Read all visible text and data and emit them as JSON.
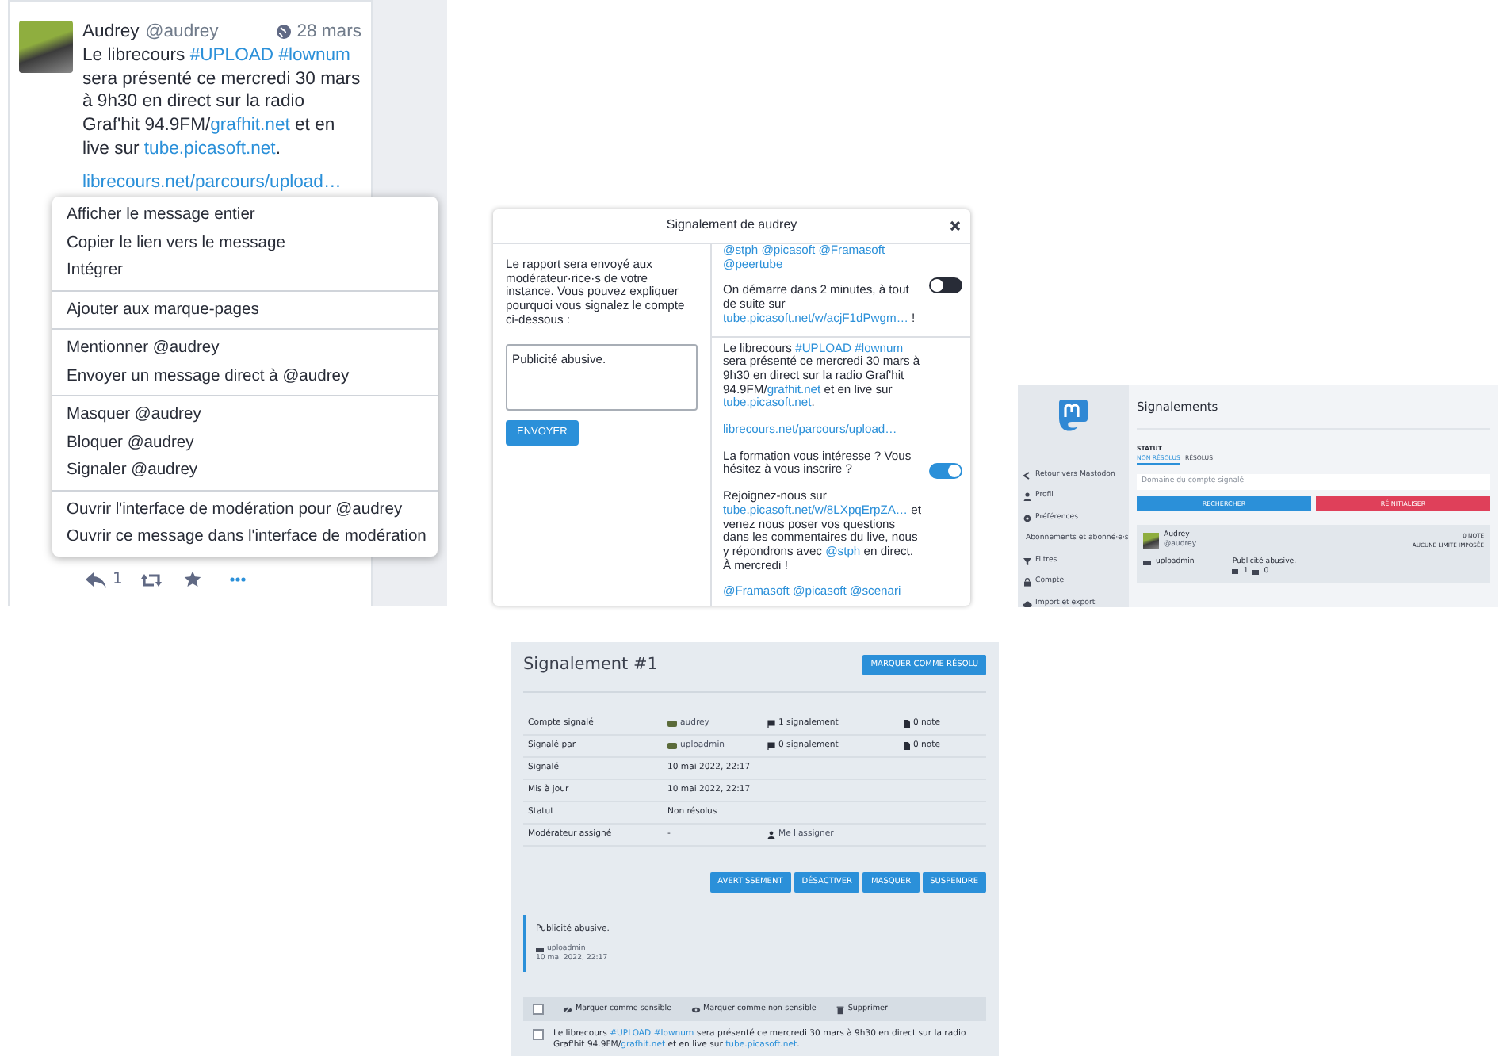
{
  "toot": {
    "author": "Audrey",
    "handle": "@audrey",
    "date": "28 mars",
    "paragraphs": [
      [
        {
          "kind": "text",
          "text": "Le librecours "
        },
        {
          "kind": "hashtag",
          "text": "#UPLOAD"
        },
        {
          "kind": "hashtag",
          "text": "#lownum"
        },
        {
          "kind": "text",
          "text": " sera présenté ce mercredi 30 mars à 9h30 en direct sur la radio Graf'hit 94.9FM/"
        },
        {
          "kind": "link",
          "text": "grafhit.net"
        },
        {
          "kind": "text",
          "text": " et en live sur "
        },
        {
          "kind": "link",
          "text": "tube.picasoft.net"
        },
        {
          "kind": "text",
          "text": "."
        }
      ],
      [
        {
          "kind": "link",
          "text": "librecours.net/parcours/upload…"
        }
      ]
    ],
    "reply_count": "1"
  },
  "context_menu": {
    "groups": [
      [
        "Afficher le message entier",
        "Copier le lien vers le message",
        "Intégrer"
      ],
      [
        "Ajouter aux marque-pages"
      ],
      [
        "Mentionner @audrey",
        "Envoyer un message direct à @audrey"
      ],
      [
        "Masquer @audrey",
        "Bloquer @audrey",
        "Signaler @audrey"
      ],
      [
        "Ouvrir l'interface de modération pour @audrey",
        "Ouvrir ce message dans l'interface de modération"
      ]
    ]
  },
  "report_dialog": {
    "title": "Signalement de audrey",
    "intro": "Le rapport sera envoyé aux modérateur·rice·s de votre instance. Vous pouvez expliquer pourquoi vous signalez le compte ci-dessous :",
    "comment": "Publicité abusive.",
    "submit": "ENVOYER",
    "statuses": [
      {
        "checked": false,
        "paragraphs": [
          [
            {
              "kind": "mention",
              "text": "@stph"
            },
            {
              "kind": "mention",
              "text": "@picasoft"
            },
            {
              "kind": "mention",
              "text": "@Framasoft"
            },
            {
              "kind": "mention",
              "text": "@peertube"
            }
          ],
          [
            {
              "kind": "text",
              "text": "On démarre dans 2 minutes, à tout de suite sur "
            },
            {
              "kind": "url",
              "text": "tube.picasoft.net/w/acjF1dPwgm…"
            },
            {
              "kind": "text",
              "text": " !"
            }
          ]
        ]
      },
      {
        "checked": true,
        "paragraphs": [
          [
            {
              "kind": "text",
              "text": "Le librecours "
            },
            {
              "kind": "hashtag",
              "text": "#UPLOAD"
            },
            {
              "kind": "hashtag",
              "text": "#lownum"
            },
            {
              "kind": "text",
              "text": " sera présenté ce mercredi 30 mars à 9h30 en direct sur la radio Graf'hit 94.9FM/"
            },
            {
              "kind": "link",
              "text": "grafhit.net"
            },
            {
              "kind": "text",
              "text": " et en live sur "
            },
            {
              "kind": "link",
              "text": "tube.picasoft.net"
            },
            {
              "kind": "text",
              "text": "."
            }
          ],
          [
            {
              "kind": "link",
              "text": "librecours.net/parcours/upload…"
            }
          ],
          [
            {
              "kind": "text",
              "text": "La formation vous intéresse ? Vous hésitez à vous inscrire ?"
            }
          ],
          [
            {
              "kind": "text",
              "text": "Rejoignez-nous sur "
            },
            {
              "kind": "url",
              "text": "tube.picasoft.net/w/8LXpqErpZA…"
            },
            {
              "kind": "text",
              "text": " et venez nous poser vos questions dans les commentaires du live, nous y répondrons avec "
            },
            {
              "kind": "mention",
              "text": "@stph"
            },
            {
              "kind": "text",
              "text": " en direct.\nÀ mercredi !"
            }
          ],
          [
            {
              "kind": "mention",
              "text": "@Framasoft"
            },
            {
              "kind": "mention",
              "text": "@picasoft"
            },
            {
              "kind": "mention",
              "text": "@scenari"
            }
          ]
        ]
      }
    ]
  },
  "admin_reports": {
    "sidebar": {
      "items": [
        {
          "kind": "back",
          "label": "Retour vers Mastodon"
        },
        {
          "kind": "user",
          "label": "Profil"
        },
        {
          "kind": "gear",
          "label": "Préférences"
        },
        {
          "kind": "users",
          "label": "Abonnements et abonné·e·s"
        },
        {
          "kind": "filter",
          "label": "Filtres"
        },
        {
          "kind": "lock",
          "label": "Compte"
        },
        {
          "kind": "cloud",
          "label": "Import et export"
        }
      ]
    },
    "title": "Signalements",
    "filter_label": "STATUT",
    "filters": [
      {
        "label": "NON RÉSOLUS",
        "selected": true
      },
      {
        "label": "RÉSOLUS",
        "selected": false
      }
    ],
    "search": {
      "placeholder": "Domaine du compte signalé"
    },
    "buttons": [
      {
        "kind": "primary",
        "label": "RECHERCHER"
      },
      {
        "kind": "danger",
        "label": "RÉINITIALISER"
      }
    ],
    "report": {
      "name": "Audrey",
      "handle": "@audrey",
      "notes": "0 NOTE",
      "limit": "AUCUNE LIMITE IMPOSÉE",
      "reporter": "uploadmin",
      "comment": "Publicité abusive.",
      "status_count": "1",
      "media_count": "0",
      "column_4": "-"
    }
  },
  "report_detail": {
    "title": "Signalement #1",
    "resolve_button": "MARQUER COMME RÉSOLU",
    "rows": [
      {
        "label": "Compte signalé",
        "value": "audrey",
        "kind": "account",
        "reports": "1 signalement",
        "notes": "0 note"
      },
      {
        "label": "Signalé par",
        "value": "uploadmin",
        "kind": "account",
        "reports": "0 signalement",
        "notes": "0 note"
      },
      {
        "label": "Signalé",
        "value": "10 mai 2022, 22:17",
        "kind": "text"
      },
      {
        "label": "Mis à jour",
        "value": "10 mai 2022, 22:17",
        "kind": "text"
      },
      {
        "label": "Statut",
        "value": "Non résolus",
        "kind": "text"
      },
      {
        "label": "Modérateur assigné",
        "value": "-",
        "kind": "assign",
        "action": "Me l'assigner"
      }
    ],
    "actions": [
      "AVERTISSEMENT",
      "DÉSACTIVER",
      "MASQUER",
      "SUSPENDRE"
    ],
    "comment": {
      "text": "Publicité abusive.",
      "author": "uploadmin",
      "date": "10 mai 2022, 22:17"
    },
    "statuses_header": {
      "checked": false,
      "actions": [
        {
          "kind": "eye-slash",
          "label": "Marquer comme sensible"
        },
        {
          "kind": "eye",
          "label": "Marquer comme non-sensible"
        },
        {
          "kind": "trash",
          "label": "Supprimer"
        }
      ]
    },
    "statuses": [
      {
        "checked": false,
        "paragraphs": [
          [
            {
              "kind": "text",
              "text": "Le librecours "
            },
            {
              "kind": "hashtag",
              "text": "#UPLOAD"
            },
            {
              "kind": "hashtag",
              "text": "#lownum"
            },
            {
              "kind": "text",
              "text": " sera présenté ce mercredi 30 mars à 9h30 en direct sur la radio Graf'hit 94.9FM/"
            },
            {
              "kind": "link",
              "text": "grafhit.net"
            },
            {
              "kind": "text",
              "text": " et en live sur "
            },
            {
              "kind": "link",
              "text": "tube.picasoft.net"
            },
            {
              "kind": "text",
              "text": "."
            }
          ]
        ]
      }
    ]
  }
}
